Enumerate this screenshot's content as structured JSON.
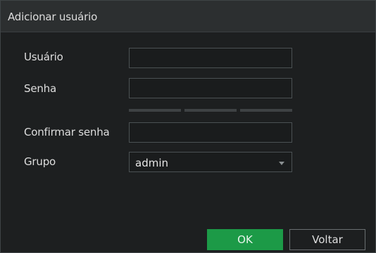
{
  "dialog": {
    "title": "Adicionar usuário"
  },
  "form": {
    "user_label": "Usuário",
    "user_value": "",
    "password_label": "Senha",
    "password_value": "",
    "confirm_label": "Confirmar senha",
    "confirm_value": "",
    "group_label": "Grupo",
    "group_value": "admin"
  },
  "buttons": {
    "ok_label": "OK",
    "back_label": "Voltar"
  },
  "colors": {
    "accent": "#1c9a47",
    "background": "#1d1f20",
    "titlebar": "#2c2f30"
  }
}
